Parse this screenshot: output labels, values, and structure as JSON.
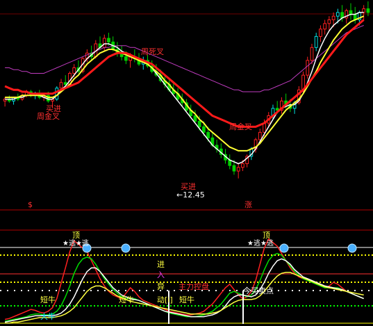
{
  "colors": {
    "background": "#000000",
    "candle_up": "#ff2020",
    "candle_up_alt": "#00e0e0",
    "candle_down": "#00d000",
    "ma_red": "#ff1a1a",
    "ma_yellow": "#ffff33",
    "ma_white": "#ffffff",
    "ma_magenta": "#c03cc0",
    "divider": "#b00000",
    "ind_red": "#ff2020",
    "ind_green": "#00dd00",
    "ind_white": "#ffffff",
    "ind_yellow": "#ffff40",
    "dot_line": "#ffff00",
    "ball": "#4ab0ff"
  },
  "icons": {
    "sell_marker": "dollar-sign",
    "rise_marker": "zhang-character",
    "level_ball": "blue-sphere"
  },
  "labels": {
    "low_price": "←12.45",
    "buy_top": "买进",
    "buy_bottom": "买进",
    "week_golden_left": "周金叉",
    "week_golden_right": "周金叉",
    "week_dead": "周死叉",
    "top_dollar": "$",
    "top_zhang": "涨",
    "peak_left": "顶",
    "peak_right": "顶",
    "star_left": "★逃★逃",
    "star_right": "★逃★逃",
    "short_bull_1": "短牛",
    "short_bull_2": "短牛",
    "short_bull_3": "短牛",
    "big_bull": "大牛",
    "enter": "进",
    "in": "入",
    "abnormal": "异",
    "move": "动[i]",
    "main_force": "主力控盘",
    "buy_sell_point": "今买卖点"
  },
  "chart_data": [
    {
      "type": "candlestick",
      "title": "",
      "annotations": [
        "←12.45",
        "买进",
        "周金叉",
        "周死叉"
      ],
      "low": 12.45,
      "candles": [
        {
          "o": 62,
          "h": 64,
          "l": 59,
          "c": 63
        },
        {
          "o": 63,
          "h": 65,
          "l": 61,
          "c": 62
        },
        {
          "o": 62,
          "h": 64,
          "l": 60,
          "c": 64
        },
        {
          "o": 64,
          "h": 66,
          "l": 62,
          "c": 63
        },
        {
          "o": 63,
          "h": 66,
          "l": 62,
          "c": 65
        },
        {
          "o": 65,
          "h": 68,
          "l": 64,
          "c": 67
        },
        {
          "o": 67,
          "h": 68,
          "l": 64,
          "c": 65
        },
        {
          "o": 65,
          "h": 67,
          "l": 63,
          "c": 66
        },
        {
          "o": 66,
          "h": 68,
          "l": 63,
          "c": 64
        },
        {
          "o": 64,
          "h": 66,
          "l": 62,
          "c": 65
        },
        {
          "o": 65,
          "h": 67,
          "l": 61,
          "c": 62
        },
        {
          "o": 62,
          "h": 64,
          "l": 58,
          "c": 63
        },
        {
          "o": 63,
          "h": 70,
          "l": 62,
          "c": 69
        },
        {
          "o": 69,
          "h": 74,
          "l": 67,
          "c": 72
        },
        {
          "o": 72,
          "h": 76,
          "l": 70,
          "c": 71
        },
        {
          "o": 71,
          "h": 78,
          "l": 70,
          "c": 77
        },
        {
          "o": 77,
          "h": 82,
          "l": 75,
          "c": 80
        },
        {
          "o": 80,
          "h": 84,
          "l": 77,
          "c": 78
        },
        {
          "o": 78,
          "h": 86,
          "l": 77,
          "c": 85
        },
        {
          "o": 85,
          "h": 90,
          "l": 83,
          "c": 88
        },
        {
          "o": 88,
          "h": 92,
          "l": 84,
          "c": 86
        },
        {
          "o": 86,
          "h": 95,
          "l": 85,
          "c": 93
        },
        {
          "o": 93,
          "h": 97,
          "l": 90,
          "c": 91
        },
        {
          "o": 91,
          "h": 98,
          "l": 89,
          "c": 96
        },
        {
          "o": 96,
          "h": 99,
          "l": 92,
          "c": 94
        },
        {
          "o": 94,
          "h": 97,
          "l": 89,
          "c": 90
        },
        {
          "o": 90,
          "h": 94,
          "l": 86,
          "c": 88
        },
        {
          "o": 88,
          "h": 92,
          "l": 84,
          "c": 86
        },
        {
          "o": 86,
          "h": 89,
          "l": 82,
          "c": 84
        },
        {
          "o": 84,
          "h": 88,
          "l": 80,
          "c": 86
        },
        {
          "o": 86,
          "h": 90,
          "l": 83,
          "c": 85
        },
        {
          "o": 85,
          "h": 88,
          "l": 81,
          "c": 82
        },
        {
          "o": 82,
          "h": 86,
          "l": 79,
          "c": 84
        },
        {
          "o": 84,
          "h": 87,
          "l": 80,
          "c": 81
        },
        {
          "o": 81,
          "h": 84,
          "l": 77,
          "c": 78
        },
        {
          "o": 78,
          "h": 82,
          "l": 75,
          "c": 76
        },
        {
          "o": 76,
          "h": 79,
          "l": 72,
          "c": 73
        },
        {
          "o": 73,
          "h": 76,
          "l": 69,
          "c": 71
        },
        {
          "o": 71,
          "h": 74,
          "l": 67,
          "c": 68
        },
        {
          "o": 68,
          "h": 72,
          "l": 65,
          "c": 66
        },
        {
          "o": 66,
          "h": 69,
          "l": 62,
          "c": 63
        },
        {
          "o": 63,
          "h": 66,
          "l": 59,
          "c": 61
        },
        {
          "o": 61,
          "h": 63,
          "l": 56,
          "c": 57
        },
        {
          "o": 57,
          "h": 60,
          "l": 53,
          "c": 54
        },
        {
          "o": 54,
          "h": 57,
          "l": 50,
          "c": 51
        },
        {
          "o": 51,
          "h": 54,
          "l": 46,
          "c": 48
        },
        {
          "o": 48,
          "h": 51,
          "l": 43,
          "c": 45
        },
        {
          "o": 45,
          "h": 48,
          "l": 40,
          "c": 42
        },
        {
          "o": 42,
          "h": 45,
          "l": 37,
          "c": 38
        },
        {
          "o": 38,
          "h": 41,
          "l": 34,
          "c": 36
        },
        {
          "o": 36,
          "h": 39,
          "l": 31,
          "c": 33
        },
        {
          "o": 33,
          "h": 36,
          "l": 28,
          "c": 30
        },
        {
          "o": 30,
          "h": 33,
          "l": 25,
          "c": 27
        },
        {
          "o": 27,
          "h": 30,
          "l": 22,
          "c": 24
        },
        {
          "o": 24,
          "h": 28,
          "l": 20,
          "c": 26
        },
        {
          "o": 26,
          "h": 30,
          "l": 24,
          "c": 28
        },
        {
          "o": 28,
          "h": 33,
          "l": 26,
          "c": 32
        },
        {
          "o": 32,
          "h": 37,
          "l": 30,
          "c": 36
        },
        {
          "o": 36,
          "h": 42,
          "l": 34,
          "c": 41
        },
        {
          "o": 41,
          "h": 47,
          "l": 39,
          "c": 45
        },
        {
          "o": 45,
          "h": 52,
          "l": 43,
          "c": 50
        },
        {
          "o": 50,
          "h": 56,
          "l": 48,
          "c": 54
        },
        {
          "o": 54,
          "h": 60,
          "l": 52,
          "c": 58
        },
        {
          "o": 58,
          "h": 62,
          "l": 55,
          "c": 57
        },
        {
          "o": 57,
          "h": 64,
          "l": 55,
          "c": 62
        },
        {
          "o": 62,
          "h": 66,
          "l": 58,
          "c": 60
        },
        {
          "o": 60,
          "h": 63,
          "l": 56,
          "c": 58
        },
        {
          "o": 58,
          "h": 62,
          "l": 55,
          "c": 61
        },
        {
          "o": 61,
          "h": 70,
          "l": 60,
          "c": 68
        },
        {
          "o": 68,
          "h": 78,
          "l": 66,
          "c": 76
        },
        {
          "o": 76,
          "h": 86,
          "l": 74,
          "c": 84
        },
        {
          "o": 84,
          "h": 93,
          "l": 82,
          "c": 91
        },
        {
          "o": 91,
          "h": 99,
          "l": 89,
          "c": 97
        },
        {
          "o": 97,
          "h": 103,
          "l": 94,
          "c": 101
        },
        {
          "o": 101,
          "h": 106,
          "l": 98,
          "c": 104
        },
        {
          "o": 104,
          "h": 108,
          "l": 100,
          "c": 106
        },
        {
          "o": 106,
          "h": 110,
          "l": 102,
          "c": 108
        },
        {
          "o": 108,
          "h": 112,
          "l": 104,
          "c": 110
        },
        {
          "o": 110,
          "h": 114,
          "l": 105,
          "c": 107
        },
        {
          "o": 107,
          "h": 112,
          "l": 104,
          "c": 111
        },
        {
          "o": 111,
          "h": 115,
          "l": 106,
          "c": 109
        },
        {
          "o": 109,
          "h": 113,
          "l": 104,
          "c": 106
        },
        {
          "o": 106,
          "h": 111,
          "l": 103,
          "c": 110
        },
        {
          "o": 110,
          "h": 114,
          "l": 106,
          "c": 112
        },
        {
          "o": 112,
          "h": 116,
          "l": 108,
          "c": 110
        }
      ],
      "ma_red": [
        70,
        69,
        68,
        68,
        67,
        67,
        66,
        66,
        66,
        66,
        66,
        66,
        67,
        68,
        69,
        70,
        71,
        72,
        74,
        76,
        78,
        80,
        82,
        84,
        86,
        87,
        88,
        88,
        88,
        87,
        86,
        85,
        84,
        83,
        82,
        80,
        78,
        76,
        74,
        72,
        70,
        68,
        66,
        64,
        62,
        60,
        58,
        56,
        54,
        53,
        52,
        51,
        50,
        49,
        48,
        48,
        48,
        48,
        48,
        49,
        50,
        52,
        54,
        56,
        58,
        60,
        62,
        64,
        66,
        68,
        71,
        74,
        77,
        80,
        83,
        86,
        89,
        92,
        95,
        98,
        100,
        102,
        104,
        106
      ],
      "ma_yellow": [
        64,
        64,
        64,
        64,
        65,
        65,
        65,
        65,
        65,
        65,
        64,
        64,
        65,
        67,
        69,
        71,
        74,
        76,
        79,
        82,
        84,
        86,
        88,
        89,
        90,
        90,
        89,
        88,
        87,
        86,
        85,
        84,
        83,
        82,
        80,
        78,
        76,
        73,
        71,
        68,
        66,
        63,
        60,
        57,
        55,
        52,
        50,
        47,
        45,
        43,
        41,
        39,
        37,
        36,
        35,
        35,
        35,
        36,
        37,
        39,
        42,
        45,
        48,
        51,
        54,
        57,
        59,
        61,
        63,
        66,
        70,
        74,
        78,
        83,
        87,
        91,
        95,
        98,
        101,
        103,
        105,
        106,
        107,
        108
      ],
      "ma_white": [
        63,
        63,
        63,
        64,
        64,
        65,
        65,
        65,
        65,
        64,
        63,
        63,
        65,
        68,
        70,
        73,
        76,
        79,
        82,
        85,
        87,
        89,
        91,
        93,
        93,
        92,
        91,
        89,
        88,
        87,
        86,
        85,
        84,
        82,
        80,
        77,
        74,
        71,
        68,
        65,
        62,
        59,
        56,
        53,
        50,
        47,
        44,
        41,
        38,
        36,
        34,
        32,
        30,
        29,
        28,
        29,
        31,
        33,
        36,
        40,
        44,
        48,
        52,
        56,
        58,
        59,
        60,
        60,
        62,
        66,
        72,
        78,
        85,
        91,
        96,
        100,
        103,
        105,
        107,
        108,
        109,
        109,
        110,
        110
      ],
      "ma_magenta": [
        80,
        80,
        79,
        79,
        78,
        78,
        77,
        77,
        77,
        77,
        78,
        79,
        80,
        81,
        82,
        83,
        84,
        85,
        86,
        87,
        88,
        89,
        90,
        91,
        91,
        92,
        92,
        92,
        92,
        91,
        91,
        90,
        89,
        88,
        87,
        86,
        85,
        84,
        83,
        82,
        81,
        80,
        79,
        78,
        77,
        76,
        75,
        74,
        73,
        72,
        71,
        70,
        69,
        68,
        68,
        67,
        67,
        67,
        67,
        67,
        68,
        68,
        69,
        70,
        71,
        72,
        73,
        75,
        77,
        79,
        81,
        83,
        85,
        87,
        89,
        91,
        93,
        95,
        97,
        99,
        100,
        101,
        102,
        103
      ]
    },
    {
      "type": "line",
      "title": "",
      "annotations": [
        "顶",
        "★逃★逃",
        "短牛",
        "大牛",
        "进",
        "入",
        "异",
        "动[i]",
        "主力控盘",
        "今买卖点"
      ],
      "series": [
        {
          "values": [
            5,
            6,
            8,
            10,
            12,
            14,
            16,
            15,
            13,
            12,
            14,
            18,
            28,
            45,
            62,
            80,
            92,
            88,
            84,
            80,
            70,
            60,
            50,
            42,
            36,
            32,
            30,
            28,
            34,
            40,
            36,
            30,
            26,
            24,
            22,
            20,
            18,
            16,
            14,
            13,
            12,
            11,
            10,
            10,
            11,
            12,
            14,
            18,
            22,
            28,
            34,
            40,
            44,
            38,
            32,
            28,
            30,
            36,
            48,
            66,
            84,
            94,
            90,
            86,
            78,
            70,
            62,
            56,
            52,
            50,
            48,
            46,
            44,
            42,
            40,
            42,
            46,
            44,
            40,
            36,
            34,
            32,
            30,
            28
          ]
        },
        {
          "values": [
            3,
            4,
            5,
            6,
            7,
            8,
            10,
            11,
            11,
            10,
            10,
            11,
            14,
            20,
            30,
            42,
            56,
            66,
            72,
            74,
            72,
            66,
            58,
            50,
            44,
            38,
            34,
            30,
            28,
            28,
            28,
            26,
            24,
            22,
            20,
            18,
            16,
            14,
            12,
            11,
            10,
            9,
            8,
            8,
            8,
            9,
            10,
            12,
            14,
            18,
            22,
            28,
            34,
            36,
            34,
            32,
            30,
            32,
            38,
            48,
            60,
            70,
            76,
            78,
            76,
            70,
            64,
            58,
            54,
            50,
            48,
            46,
            44,
            42,
            40,
            40,
            40,
            40,
            38,
            36,
            34,
            32,
            30,
            28
          ]
        },
        {
          "values": [
            2,
            3,
            4,
            5,
            6,
            7,
            8,
            9,
            9,
            9,
            9,
            9,
            10,
            12,
            16,
            22,
            30,
            40,
            50,
            58,
            62,
            62,
            58,
            52,
            46,
            40,
            36,
            32,
            30,
            28,
            27,
            26,
            24,
            22,
            20,
            18,
            16,
            14,
            13,
            12,
            11,
            10,
            9,
            8,
            8,
            8,
            8,
            9,
            10,
            12,
            15,
            20,
            26,
            30,
            32,
            32,
            31,
            30,
            32,
            38,
            46,
            56,
            64,
            70,
            72,
            70,
            66,
            60,
            56,
            52,
            50,
            48,
            46,
            44,
            42,
            41,
            40,
            39,
            38,
            36,
            34,
            32,
            30,
            28
          ]
        },
        {
          "values": [
            1,
            1,
            2,
            2,
            3,
            4,
            5,
            6,
            7,
            7,
            7,
            7,
            8,
            9,
            11,
            14,
            18,
            24,
            30,
            36,
            40,
            42,
            42,
            40,
            37,
            34,
            31,
            29,
            27,
            25,
            24,
            23,
            22,
            21,
            20,
            19,
            18,
            17,
            16,
            15,
            14,
            13,
            12,
            11,
            11,
            11,
            11,
            11,
            12,
            13,
            15,
            18,
            21,
            24,
            26,
            27,
            27,
            27,
            28,
            31,
            36,
            42,
            48,
            53,
            56,
            57,
            57,
            55,
            53,
            51,
            49,
            47,
            45,
            43,
            41,
            40,
            39,
            38,
            37,
            36,
            35,
            34,
            33,
            32
          ]
        }
      ]
    }
  ]
}
